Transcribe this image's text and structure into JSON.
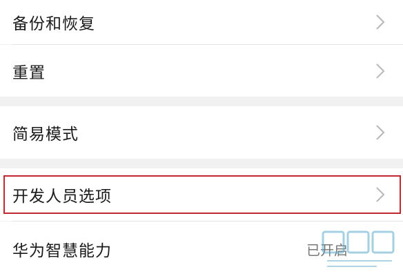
{
  "settings": {
    "items": [
      {
        "label": "备份和恢复"
      },
      {
        "label": "重置"
      },
      {
        "label": "简易模式"
      },
      {
        "label": "开发人员选项"
      },
      {
        "label": "华为智慧能力"
      }
    ],
    "partial_trailing": "已开启"
  },
  "colors": {
    "background": "#f1f1f1",
    "row": "#ffffff",
    "highlight": "#c0262d",
    "chevron": "#b8b8b8"
  },
  "icons": {
    "chevron": "chevron-right-icon"
  }
}
